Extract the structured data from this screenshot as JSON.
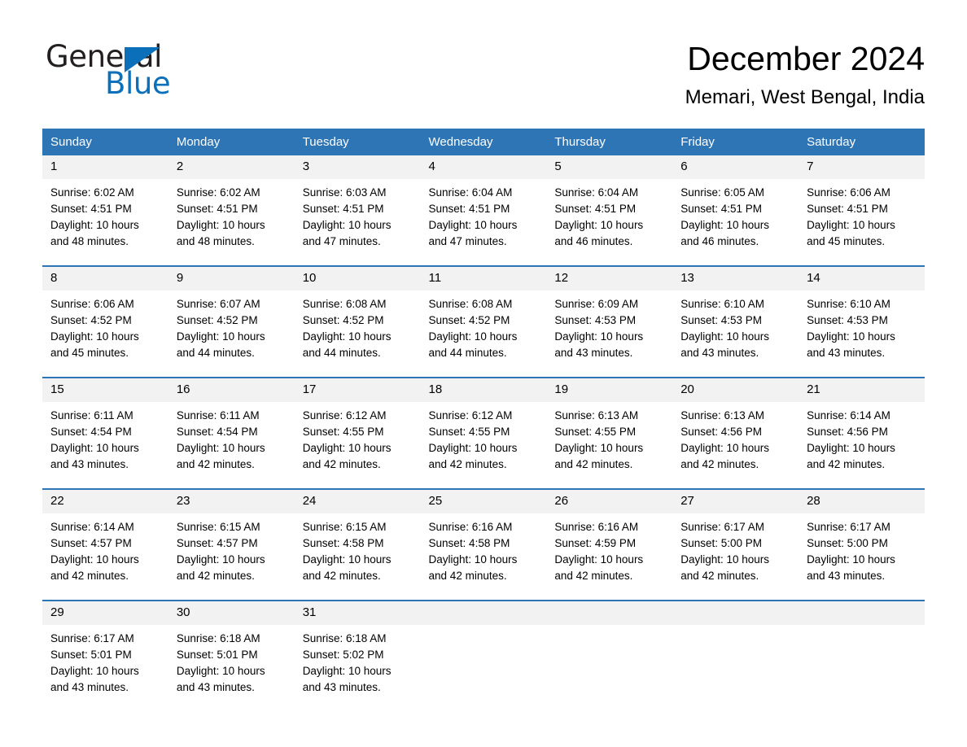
{
  "brand": {
    "name_part1": "General",
    "name_part2": "Blue",
    "triangle_icon": "blue-triangle-icon",
    "accent_color": "#0b6fba"
  },
  "header": {
    "title": "December 2024",
    "subtitle": "Memari, West Bengal, India"
  },
  "theme": {
    "header_blue": "#2e75b6",
    "daynum_gray": "#f2f2f2",
    "text_black": "#000000"
  },
  "calendar": {
    "weekday_headers": [
      "Sunday",
      "Monday",
      "Tuesday",
      "Wednesday",
      "Thursday",
      "Friday",
      "Saturday"
    ],
    "weeks": [
      [
        {
          "day": "1",
          "sunrise": "Sunrise: 6:02 AM",
          "sunset": "Sunset: 4:51 PM",
          "daylight_line1": "Daylight: 10 hours",
          "daylight_line2": "and 48 minutes."
        },
        {
          "day": "2",
          "sunrise": "Sunrise: 6:02 AM",
          "sunset": "Sunset: 4:51 PM",
          "daylight_line1": "Daylight: 10 hours",
          "daylight_line2": "and 48 minutes."
        },
        {
          "day": "3",
          "sunrise": "Sunrise: 6:03 AM",
          "sunset": "Sunset: 4:51 PM",
          "daylight_line1": "Daylight: 10 hours",
          "daylight_line2": "and 47 minutes."
        },
        {
          "day": "4",
          "sunrise": "Sunrise: 6:04 AM",
          "sunset": "Sunset: 4:51 PM",
          "daylight_line1": "Daylight: 10 hours",
          "daylight_line2": "and 47 minutes."
        },
        {
          "day": "5",
          "sunrise": "Sunrise: 6:04 AM",
          "sunset": "Sunset: 4:51 PM",
          "daylight_line1": "Daylight: 10 hours",
          "daylight_line2": "and 46 minutes."
        },
        {
          "day": "6",
          "sunrise": "Sunrise: 6:05 AM",
          "sunset": "Sunset: 4:51 PM",
          "daylight_line1": "Daylight: 10 hours",
          "daylight_line2": "and 46 minutes."
        },
        {
          "day": "7",
          "sunrise": "Sunrise: 6:06 AM",
          "sunset": "Sunset: 4:51 PM",
          "daylight_line1": "Daylight: 10 hours",
          "daylight_line2": "and 45 minutes."
        }
      ],
      [
        {
          "day": "8",
          "sunrise": "Sunrise: 6:06 AM",
          "sunset": "Sunset: 4:52 PM",
          "daylight_line1": "Daylight: 10 hours",
          "daylight_line2": "and 45 minutes."
        },
        {
          "day": "9",
          "sunrise": "Sunrise: 6:07 AM",
          "sunset": "Sunset: 4:52 PM",
          "daylight_line1": "Daylight: 10 hours",
          "daylight_line2": "and 44 minutes."
        },
        {
          "day": "10",
          "sunrise": "Sunrise: 6:08 AM",
          "sunset": "Sunset: 4:52 PM",
          "daylight_line1": "Daylight: 10 hours",
          "daylight_line2": "and 44 minutes."
        },
        {
          "day": "11",
          "sunrise": "Sunrise: 6:08 AM",
          "sunset": "Sunset: 4:52 PM",
          "daylight_line1": "Daylight: 10 hours",
          "daylight_line2": "and 44 minutes."
        },
        {
          "day": "12",
          "sunrise": "Sunrise: 6:09 AM",
          "sunset": "Sunset: 4:53 PM",
          "daylight_line1": "Daylight: 10 hours",
          "daylight_line2": "and 43 minutes."
        },
        {
          "day": "13",
          "sunrise": "Sunrise: 6:10 AM",
          "sunset": "Sunset: 4:53 PM",
          "daylight_line1": "Daylight: 10 hours",
          "daylight_line2": "and 43 minutes."
        },
        {
          "day": "14",
          "sunrise": "Sunrise: 6:10 AM",
          "sunset": "Sunset: 4:53 PM",
          "daylight_line1": "Daylight: 10 hours",
          "daylight_line2": "and 43 minutes."
        }
      ],
      [
        {
          "day": "15",
          "sunrise": "Sunrise: 6:11 AM",
          "sunset": "Sunset: 4:54 PM",
          "daylight_line1": "Daylight: 10 hours",
          "daylight_line2": "and 43 minutes."
        },
        {
          "day": "16",
          "sunrise": "Sunrise: 6:11 AM",
          "sunset": "Sunset: 4:54 PM",
          "daylight_line1": "Daylight: 10 hours",
          "daylight_line2": "and 42 minutes."
        },
        {
          "day": "17",
          "sunrise": "Sunrise: 6:12 AM",
          "sunset": "Sunset: 4:55 PM",
          "daylight_line1": "Daylight: 10 hours",
          "daylight_line2": "and 42 minutes."
        },
        {
          "day": "18",
          "sunrise": "Sunrise: 6:12 AM",
          "sunset": "Sunset: 4:55 PM",
          "daylight_line1": "Daylight: 10 hours",
          "daylight_line2": "and 42 minutes."
        },
        {
          "day": "19",
          "sunrise": "Sunrise: 6:13 AM",
          "sunset": "Sunset: 4:55 PM",
          "daylight_line1": "Daylight: 10 hours",
          "daylight_line2": "and 42 minutes."
        },
        {
          "day": "20",
          "sunrise": "Sunrise: 6:13 AM",
          "sunset": "Sunset: 4:56 PM",
          "daylight_line1": "Daylight: 10 hours",
          "daylight_line2": "and 42 minutes."
        },
        {
          "day": "21",
          "sunrise": "Sunrise: 6:14 AM",
          "sunset": "Sunset: 4:56 PM",
          "daylight_line1": "Daylight: 10 hours",
          "daylight_line2": "and 42 minutes."
        }
      ],
      [
        {
          "day": "22",
          "sunrise": "Sunrise: 6:14 AM",
          "sunset": "Sunset: 4:57 PM",
          "daylight_line1": "Daylight: 10 hours",
          "daylight_line2": "and 42 minutes."
        },
        {
          "day": "23",
          "sunrise": "Sunrise: 6:15 AM",
          "sunset": "Sunset: 4:57 PM",
          "daylight_line1": "Daylight: 10 hours",
          "daylight_line2": "and 42 minutes."
        },
        {
          "day": "24",
          "sunrise": "Sunrise: 6:15 AM",
          "sunset": "Sunset: 4:58 PM",
          "daylight_line1": "Daylight: 10 hours",
          "daylight_line2": "and 42 minutes."
        },
        {
          "day": "25",
          "sunrise": "Sunrise: 6:16 AM",
          "sunset": "Sunset: 4:58 PM",
          "daylight_line1": "Daylight: 10 hours",
          "daylight_line2": "and 42 minutes."
        },
        {
          "day": "26",
          "sunrise": "Sunrise: 6:16 AM",
          "sunset": "Sunset: 4:59 PM",
          "daylight_line1": "Daylight: 10 hours",
          "daylight_line2": "and 42 minutes."
        },
        {
          "day": "27",
          "sunrise": "Sunrise: 6:17 AM",
          "sunset": "Sunset: 5:00 PM",
          "daylight_line1": "Daylight: 10 hours",
          "daylight_line2": "and 42 minutes."
        },
        {
          "day": "28",
          "sunrise": "Sunrise: 6:17 AM",
          "sunset": "Sunset: 5:00 PM",
          "daylight_line1": "Daylight: 10 hours",
          "daylight_line2": "and 43 minutes."
        }
      ],
      [
        {
          "day": "29",
          "sunrise": "Sunrise: 6:17 AM",
          "sunset": "Sunset: 5:01 PM",
          "daylight_line1": "Daylight: 10 hours",
          "daylight_line2": "and 43 minutes."
        },
        {
          "day": "30",
          "sunrise": "Sunrise: 6:18 AM",
          "sunset": "Sunset: 5:01 PM",
          "daylight_line1": "Daylight: 10 hours",
          "daylight_line2": "and 43 minutes."
        },
        {
          "day": "31",
          "sunrise": "Sunrise: 6:18 AM",
          "sunset": "Sunset: 5:02 PM",
          "daylight_line1": "Daylight: 10 hours",
          "daylight_line2": "and 43 minutes."
        },
        {
          "day": "",
          "sunrise": "",
          "sunset": "",
          "daylight_line1": "",
          "daylight_line2": ""
        },
        {
          "day": "",
          "sunrise": "",
          "sunset": "",
          "daylight_line1": "",
          "daylight_line2": ""
        },
        {
          "day": "",
          "sunrise": "",
          "sunset": "",
          "daylight_line1": "",
          "daylight_line2": ""
        },
        {
          "day": "",
          "sunrise": "",
          "sunset": "",
          "daylight_line1": "",
          "daylight_line2": ""
        }
      ]
    ]
  }
}
